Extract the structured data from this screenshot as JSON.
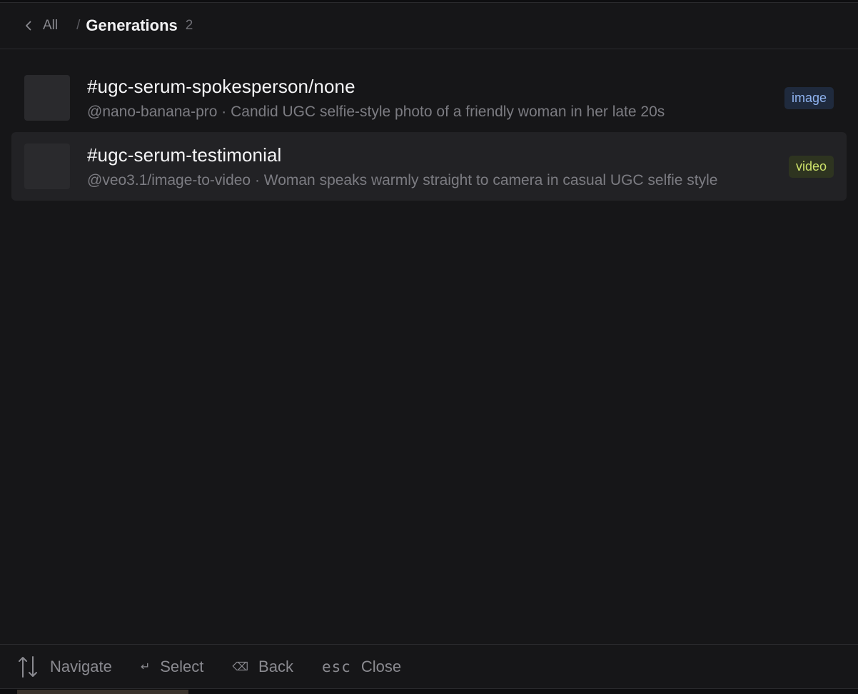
{
  "header": {
    "back_label": "All",
    "separator": "/",
    "title": "Generations",
    "count": "2"
  },
  "items": [
    {
      "title": "#ugc-serum-spokesperson/none",
      "subtitle": "@nano-banana-pro · Candid UGC selfie-style photo of a friendly woman in her late 20s",
      "badge": "image",
      "selected": false
    },
    {
      "title": "#ugc-serum-testimonial",
      "subtitle": "@veo3.1/image-to-video · Woman speaks warmly straight to camera in casual UGC selfie style",
      "badge": "video",
      "selected": true
    }
  ],
  "footer": {
    "navigate_label": "Navigate",
    "select_key": "↵",
    "select_label": "Select",
    "back_key": "⌫",
    "back_label": "Back",
    "close_key": "esc",
    "close_label": "Close"
  },
  "colors": {
    "background": "#161618",
    "selected_row": "#222225",
    "image_badge": "#8fb3f0",
    "video_badge": "#cde26a"
  },
  "icons": [
    "chevron-left-icon",
    "arrows-up-down-icon",
    "enter-key-icon",
    "backspace-key-icon"
  ]
}
